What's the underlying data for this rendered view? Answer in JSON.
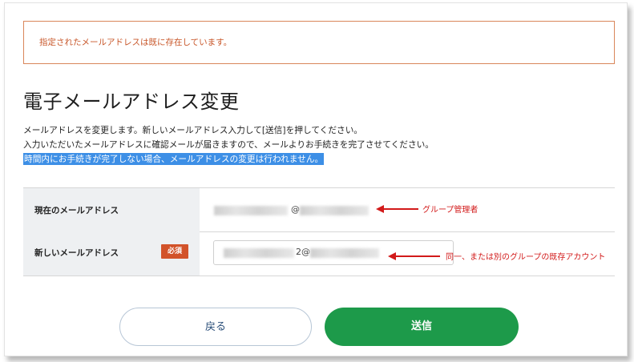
{
  "alert": {
    "message": "指定されたメールアドレスは既に存在しています。"
  },
  "page": {
    "title": "電子メールアドレス変更"
  },
  "description": {
    "line1": "メールアドレスを変更します。新しいメールアドレス入力して[送信]を押してください。",
    "line2": "入力いただいたメールアドレスに確認メールが届きますので、メールよりお手続きを完了させてください。",
    "line3": "時間内にお手続きが完了しない場合、メールアドレスの変更は行われません。"
  },
  "form": {
    "current": {
      "label": "現在のメールアドレス",
      "value_visible_part": "@"
    },
    "new": {
      "label": "新しいメールアドレス",
      "required_badge": "必須",
      "value_visible_part": "2@"
    }
  },
  "annotations": {
    "current": "グループ管理者",
    "new": "同一、または別のグループの既存アカウント"
  },
  "buttons": {
    "back": "戻る",
    "send": "送信"
  },
  "colors": {
    "alert_border": "#d9865a",
    "alert_text": "#c8572a",
    "highlight": "#3d8fe6",
    "required_badge": "#d2532a",
    "annotation_red": "#d21a1a",
    "send_button": "#1d9a4a",
    "back_button_text": "#2b4f7a"
  }
}
